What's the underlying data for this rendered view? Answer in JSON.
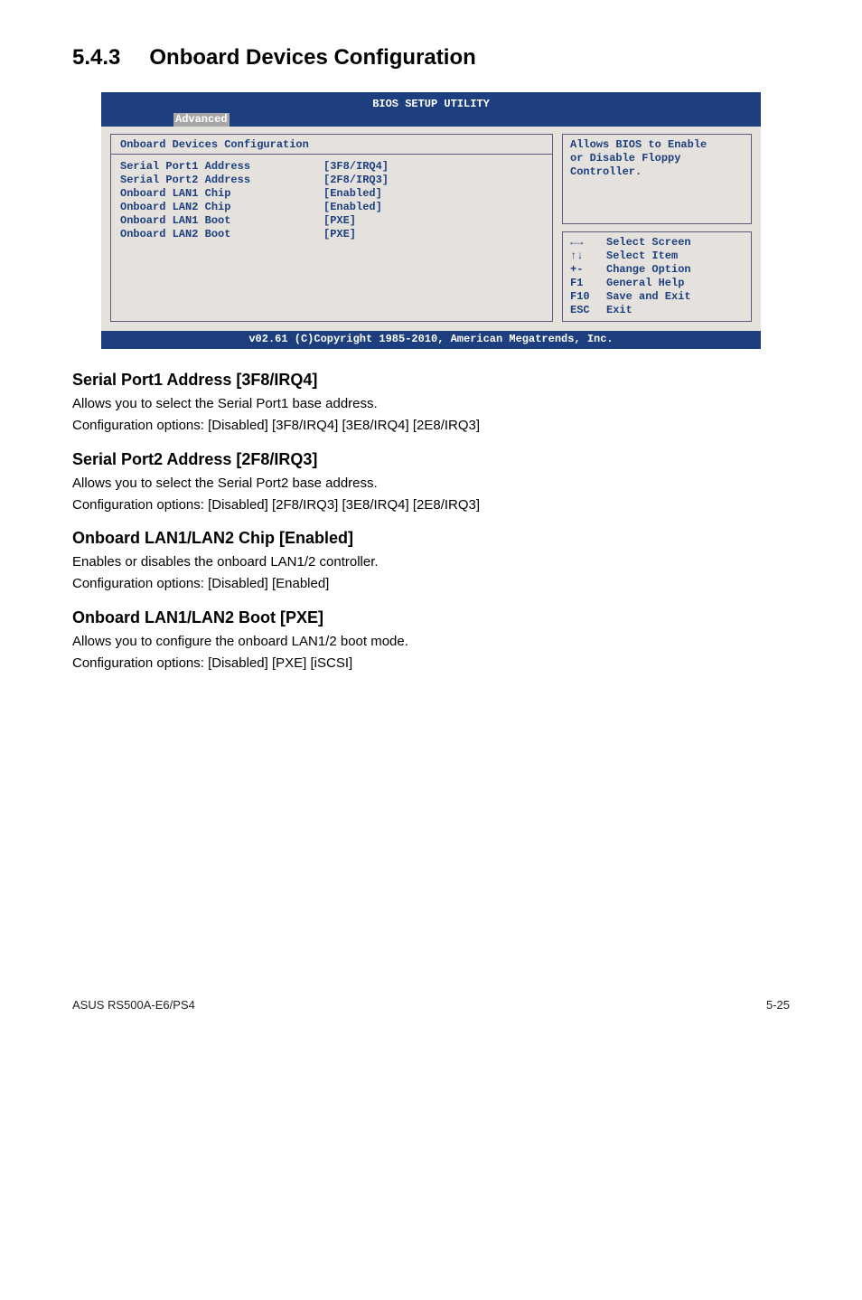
{
  "heading": {
    "number": "5.4.3",
    "title": "Onboard Devices Configuration"
  },
  "bios": {
    "title": "BIOS SETUP UTILITY",
    "tab": "Advanced",
    "panel_heading": "Onboard Devices Configuration",
    "rows": [
      {
        "label": "Serial Port1 Address",
        "value": "[3F8/IRQ4]"
      },
      {
        "label": "Serial Port2 Address",
        "value": "[2F8/IRQ3]"
      },
      {
        "label": "Onboard LAN1 Chip",
        "value": "[Enabled]"
      },
      {
        "label": "Onboard LAN2 Chip",
        "value": "[Enabled]"
      },
      {
        "label": "Onboard LAN1 Boot",
        "value": "[PXE]"
      },
      {
        "label": "Onboard LAN2 Boot",
        "value": "[PXE]"
      }
    ],
    "help": {
      "line1": "Allows BIOS to Enable",
      "line2": "or Disable Floppy",
      "line3": "Controller."
    },
    "nav": [
      {
        "key": "←→",
        "desc": "Select Screen"
      },
      {
        "key": "↑↓",
        "desc": "Select Item"
      },
      {
        "key": "+-",
        "desc": "Change Option"
      },
      {
        "key": "F1",
        "desc": "General Help"
      },
      {
        "key": "F10",
        "desc": "Save and Exit"
      },
      {
        "key": "ESC",
        "desc": "Exit"
      }
    ],
    "footer": "v02.61 (C)Copyright 1985-2010, American Megatrends, Inc."
  },
  "sections": [
    {
      "heading": "Serial Port1 Address [3F8/IRQ4]",
      "p1": "Allows you to select the Serial Port1 base address.",
      "p2": "Configuration options: [Disabled] [3F8/IRQ4] [3E8/IRQ4] [2E8/IRQ3]"
    },
    {
      "heading": "Serial Port2 Address [2F8/IRQ3]",
      "p1": "Allows you to select the Serial Port2 base address.",
      "p2": "Configuration options: [Disabled] [2F8/IRQ3] [3E8/IRQ4] [2E8/IRQ3]"
    },
    {
      "heading": "Onboard LAN1/LAN2 Chip [Enabled]",
      "p1": "Enables or disables the onboard LAN1/2 controller.",
      "p2": "Configuration options: [Disabled] [Enabled]"
    },
    {
      "heading": "Onboard LAN1/LAN2 Boot [PXE]",
      "p1": "Allows you to configure the onboard LAN1/2 boot mode.",
      "p2": "Configuration options: [Disabled] [PXE] [iSCSI]"
    }
  ],
  "footer": {
    "left": "ASUS RS500A-E6/PS4",
    "right": "5-25"
  }
}
